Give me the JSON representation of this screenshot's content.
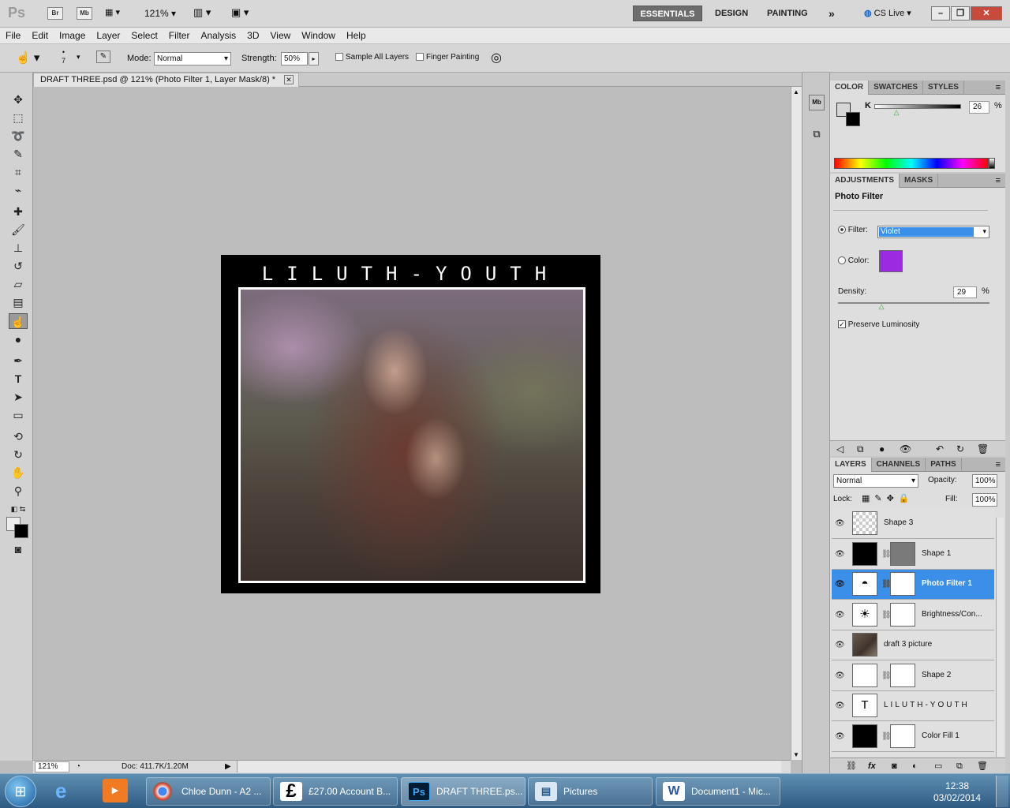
{
  "app": {
    "logo": "Ps",
    "bridge": "Br",
    "mini_bridge": "Mb",
    "zoom": "121%"
  },
  "workspaces": {
    "essentials": "ESSENTIALS",
    "design": "DESIGN",
    "painting": "PAINTING",
    "more": "»",
    "cs_live": "CS Live"
  },
  "menu": [
    "File",
    "Edit",
    "Image",
    "Layer",
    "Select",
    "Filter",
    "Analysis",
    "3D",
    "View",
    "Window",
    "Help"
  ],
  "options": {
    "brush_size": "7",
    "mode_label": "Mode:",
    "mode_value": "Normal",
    "strength_label": "Strength:",
    "strength_value": "50%",
    "sample_all": "Sample All Layers",
    "finger": "Finger Painting"
  },
  "document": {
    "tab": "DRAFT THREE.psd @ 121% (Photo Filter 1, Layer Mask/8) *",
    "status_zoom": "121%",
    "doc_info": "Doc: 411.7K/1.20M",
    "art_title": "LILUTH-YOUTH"
  },
  "color_panel": {
    "tabs": [
      "COLOR",
      "SWATCHES",
      "STYLES"
    ],
    "k_label": "K",
    "k_value": "26",
    "percent": "%",
    "k_level_pct": 26
  },
  "adjustments": {
    "tabs": [
      "ADJUSTMENTS",
      "MASKS"
    ],
    "title": "Photo Filter",
    "filter_label": "Filter:",
    "filter_value": "Violet",
    "color_label": "Color:",
    "swatch": "#9b2be0",
    "density_label": "Density:",
    "density_value": "29",
    "percent": "%",
    "preserve": "Preserve Luminosity",
    "density_level_pct": 29
  },
  "layers_panel": {
    "tabs": [
      "LAYERS",
      "CHANNELS",
      "PATHS"
    ],
    "blend": "Normal",
    "opacity_label": "Opacity:",
    "opacity": "100%",
    "lock_label": "Lock:",
    "fill_label": "Fill:",
    "fill": "100%",
    "layers": [
      {
        "name": "Shape 3",
        "thumb": "checker",
        "mask": false,
        "selected": false
      },
      {
        "name": "Shape 1",
        "thumb": "black",
        "mask": "gray",
        "selected": false
      },
      {
        "name": "Photo Filter 1",
        "thumb": "adjust",
        "mask": "white",
        "selected": true
      },
      {
        "name": "Brightness/Con...",
        "thumb": "sun",
        "mask": "white",
        "selected": false
      },
      {
        "name": "draft 3 picture",
        "thumb": "photo",
        "mask": false,
        "selected": false
      },
      {
        "name": "Shape 2",
        "thumb": "white",
        "mask": "white",
        "selected": false
      },
      {
        "name": "LILUTH-YOUTH",
        "thumb": "text",
        "mask": false,
        "selected": false
      },
      {
        "name": "Color Fill 1",
        "thumb": "black",
        "mask": "white",
        "selected": false
      }
    ]
  },
  "taskbar": {
    "items": [
      "Chloe Dunn - A2 ...",
      "£27.00 Account B...",
      "DRAFT THREE.ps...",
      "Pictures",
      "Document1 - Mic..."
    ],
    "time": "12:38",
    "date": "03/02/2014"
  }
}
